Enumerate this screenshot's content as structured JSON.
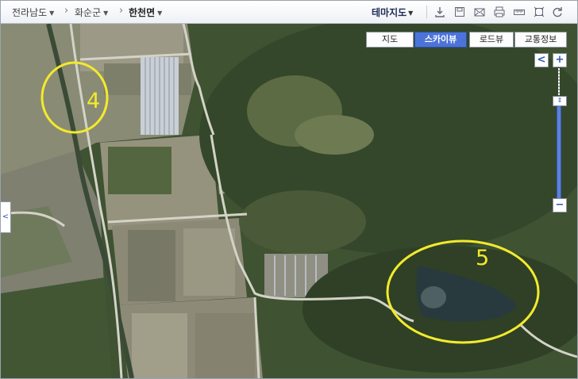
{
  "breadcrumb": {
    "province": "전라남도",
    "county": "화순군",
    "town": "한천면"
  },
  "theme_map_label": "테마지도",
  "toolbar_icons": [
    "download-icon",
    "save-icon",
    "mail-icon",
    "print-icon",
    "ruler-icon",
    "fullscreen-icon",
    "refresh-icon"
  ],
  "view_buttons": {
    "map": "지도",
    "skyview": "스카이뷰",
    "roadview": "로드뷰",
    "traffic": "교통정보",
    "active": "스카이뷰"
  },
  "zoom": {
    "in": "+",
    "out": "−",
    "prev": "<"
  },
  "side_tab_arrow": "<",
  "markers": [
    {
      "label": "4",
      "color": "#f2ea2c"
    },
    {
      "label": "5",
      "color": "#f2ea2c"
    }
  ]
}
